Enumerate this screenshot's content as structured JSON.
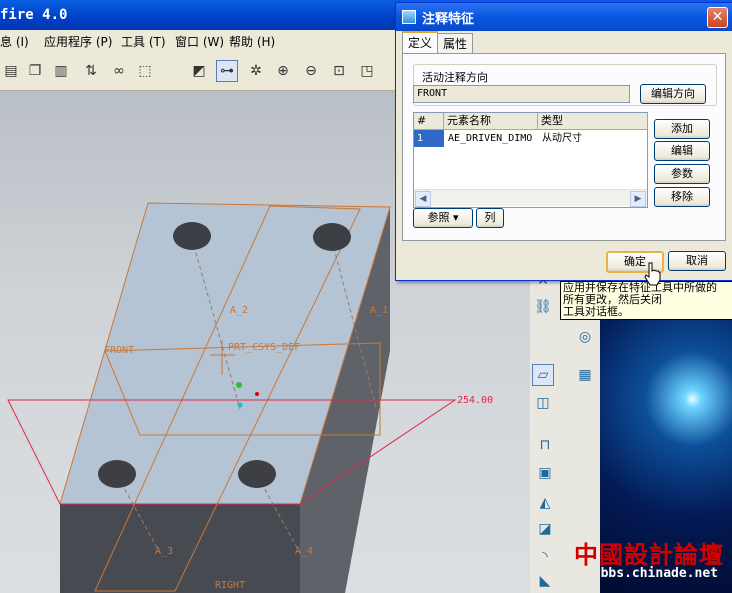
{
  "main_window": {
    "title": "fire 4.0"
  },
  "menu": [
    "息 (I)",
    "应用程序 (P)",
    "工具 (T)",
    "窗口 (W)",
    "帮助 (H)"
  ],
  "toolbar_icons": [
    "paste-icon",
    "copy-icon",
    "clipboard-icon",
    "regenerate-icon",
    "binoculars-icon",
    "select-box-icon",
    "repaint-icon",
    "spin-center-icon",
    "orient-icon",
    "zoom-in-icon",
    "zoom-out-icon",
    "zoom-fit-icon",
    "view-icon"
  ],
  "model": {
    "labels": {
      "front": "FRONT",
      "csys": "PRT_CSYS_DEF",
      "a2": "A_2",
      "a1": "A_1",
      "a3": "A_3",
      "a4": "A_4",
      "right": "RIGHT",
      "dimension": "254.00"
    }
  },
  "dialog": {
    "title": "注释特征",
    "tabs": [
      "定义",
      "属性"
    ],
    "active_direction_label": "活动注释方向",
    "direction_value": "FRONT",
    "edit_direction_button": "编辑方向",
    "table": {
      "headers": [
        "#",
        "元素名称",
        "类型"
      ],
      "rows": [
        {
          "num": "1",
          "name": "AE_DRIVEN_DIMO",
          "type": "从动尺寸"
        }
      ]
    },
    "side_buttons": [
      "添加",
      "编辑",
      "参数",
      "移除"
    ],
    "reference_button": "参照",
    "column_button": "列",
    "ok_button": "确定",
    "cancel_button": "取消"
  },
  "tooltip": {
    "lines": [
      "应用并保存在特征工具中所做的",
      "所有更改，然后关闭",
      "工具对话框。"
    ]
  },
  "watermark": {
    "chinese": "中國設計論壇",
    "url": "bbs.chinade.net"
  },
  "colors": {
    "title_blue": "#0a56e0",
    "model_face": "#b5c4d4",
    "model_side": "#474a50",
    "datum_orange": "#c87837",
    "sketch_red": "#e0284a"
  }
}
